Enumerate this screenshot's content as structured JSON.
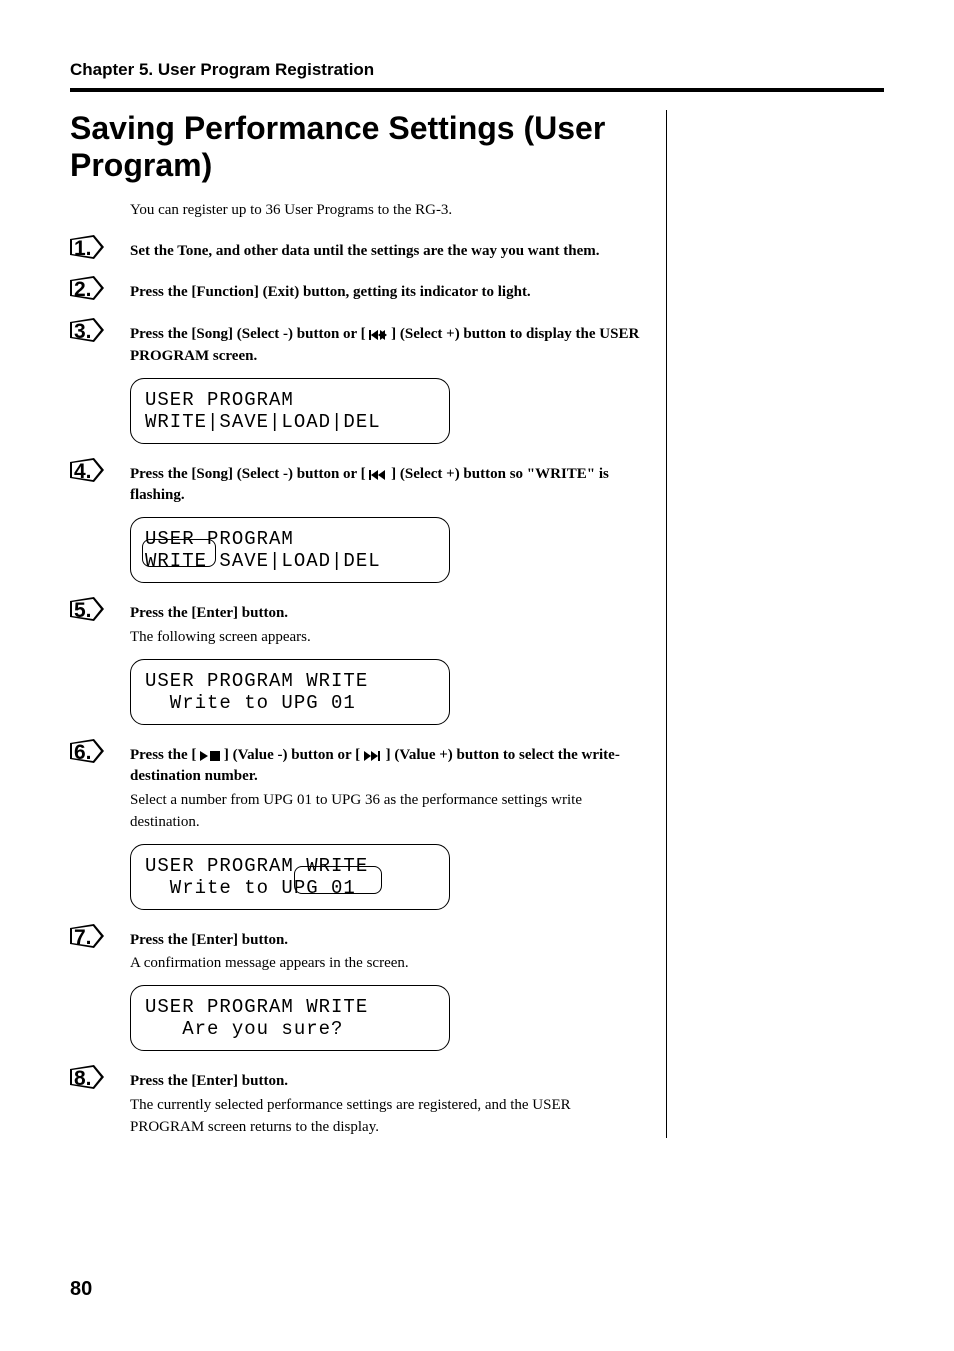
{
  "chapter": "Chapter 5. User Program Registration",
  "title": "Saving Performance Settings (User Program)",
  "intro": "You can register up to 36 User Programs to the RG-3.",
  "steps": [
    {
      "num": "1.",
      "bold": "Set the Tone, and other data until the settings are the way you want them."
    },
    {
      "num": "2.",
      "bold": "Press the [Function] (Exit) button, getting its indicator to light."
    },
    {
      "num": "3.",
      "bold_pre": "Press the [Song] (Select -) button or [ ",
      "bold_post": " ] (Select +) button to display the USER PROGRAM screen.",
      "lcd": {
        "l1": "USER PROGRAM",
        "l2": "WRITE|SAVE|LOAD|DEL"
      }
    },
    {
      "num": "4.",
      "bold_pre": "Press the [Song] (Select -) button or [ ",
      "bold_post": " ] (Select +) button so \"WRITE\" is flashing.",
      "lcd": {
        "l1": "USER PROGRAM",
        "l2": "WRITE SAVE|LOAD|DEL",
        "ring_write": true
      }
    },
    {
      "num": "5.",
      "bold": "Press the [Enter] button.",
      "plain": "The following screen appears.",
      "lcd": {
        "l1": "USER PROGRAM WRITE",
        "l2": "  Write to UPG 01"
      }
    },
    {
      "num": "6.",
      "bold_pre": "Press the [ ",
      "bold_mid": " ] (Value -) button or [ ",
      "bold_post": " ] (Value +) button to select the write-destination number.",
      "plain": "Select a number from UPG 01 to UPG 36 as the performance settings write destination.",
      "lcd": {
        "l1": "USER PROGRAM WRITE",
        "l2": "  Write to UPG 01",
        "ring_upg": true
      }
    },
    {
      "num": "7.",
      "bold": "Press the [Enter] button.",
      "plain": "A confirmation message appears in the screen.",
      "lcd": {
        "l1": "USER PROGRAM WRITE",
        "l2": "   Are you sure?"
      }
    },
    {
      "num": "8.",
      "bold": "Press the [Enter] button.",
      "plain": "The currently selected performance settings are registered, and the USER PROGRAM screen returns to the display."
    }
  ],
  "page_number": "80"
}
